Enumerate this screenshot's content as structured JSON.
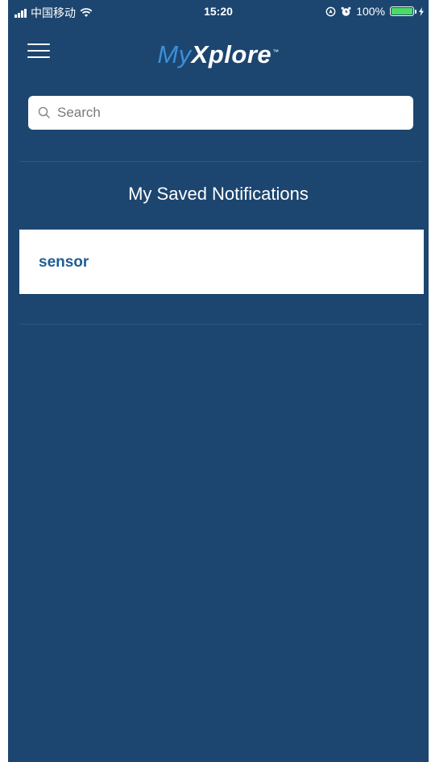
{
  "status_bar": {
    "carrier": "中国移动",
    "time": "15:20",
    "battery": "100%",
    "battery_color": "#4cd964"
  },
  "header": {
    "menu_icon": "hamburger-menu-icon",
    "logo_prefix": "My",
    "logo_main": "Xplore",
    "logo_tm": "™"
  },
  "search": {
    "placeholder": "Search",
    "value": ""
  },
  "section": {
    "title": "My Saved Notifications"
  },
  "notifications": [
    {
      "label": "sensor"
    }
  ],
  "colors": {
    "background": "#1c4670",
    "accent": "#1f5c97",
    "logo_prefix": "#3d8fd6"
  }
}
